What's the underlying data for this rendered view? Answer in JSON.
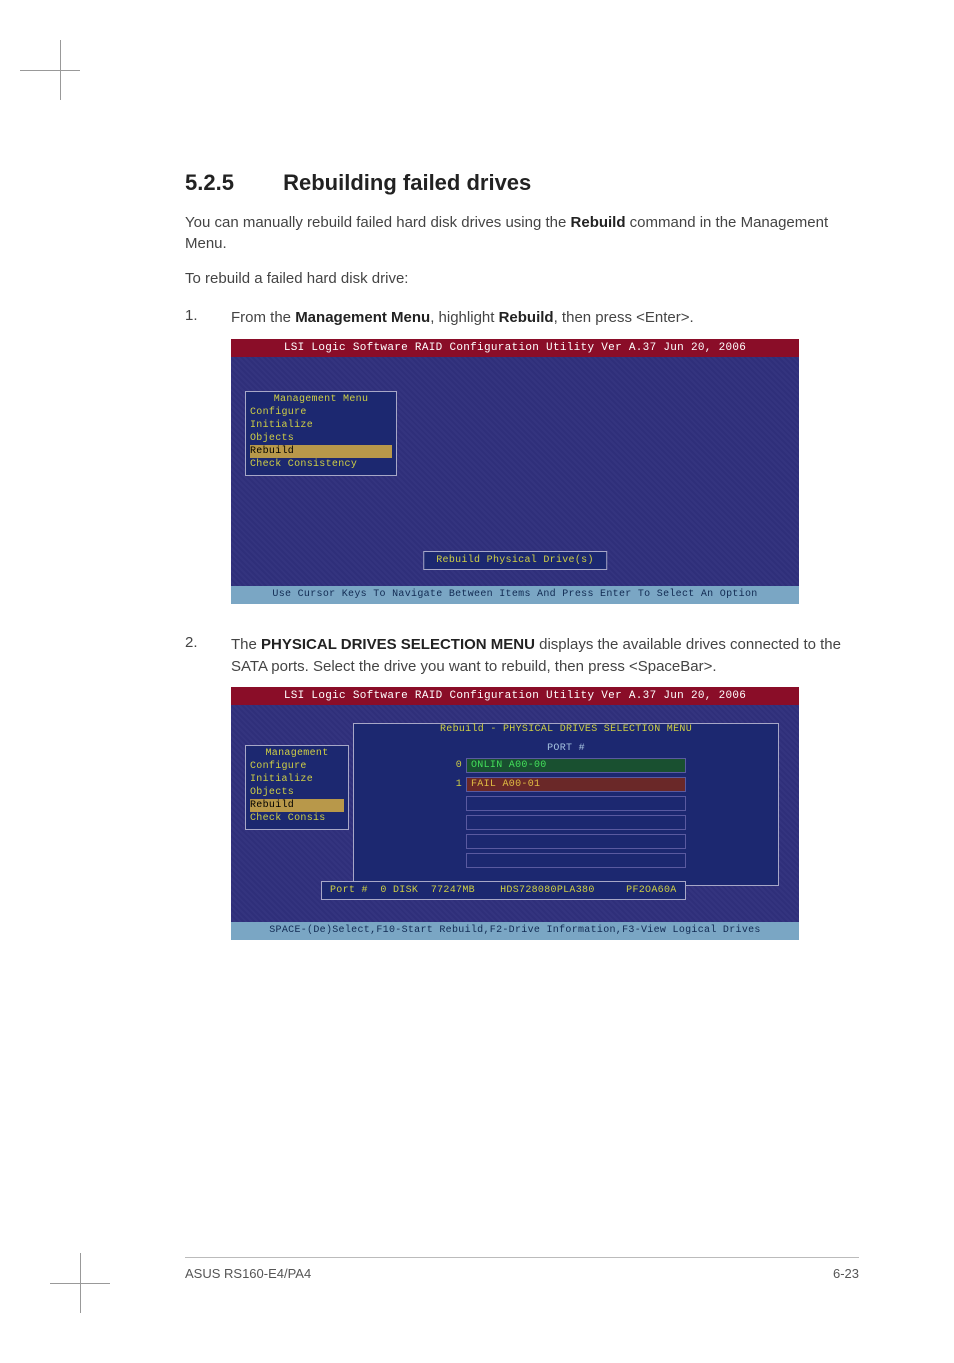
{
  "section": {
    "number": "5.2.5",
    "title": "Rebuilding failed drives"
  },
  "intro1a": "You can manually rebuild failed hard disk drives using the ",
  "intro1_bold": "Rebuild",
  "intro1b": " command in the Management Menu.",
  "intro2": "To rebuild a failed hard disk drive:",
  "steps": [
    {
      "num": "1.",
      "parts": [
        "From the ",
        "Management Menu",
        ", highlight ",
        "Rebuild",
        ", then press <Enter>."
      ]
    },
    {
      "num": "2.",
      "parts": [
        "The ",
        "PHYSICAL DRIVES SELECTION MENU",
        " displays the available drives connected to the SATA ports. Select the drive you want to rebuild, then press <SpaceBar>."
      ]
    }
  ],
  "bios": {
    "titlebar": "LSI Logic Software RAID Configuration Utility Ver A.37 Jun 20, 2006",
    "footer1": "Use Cursor Keys To Navigate Between Items And Press Enter To Select An Option",
    "footer2": "SPACE-(De)Select,F10-Start Rebuild,F2-Drive Information,F3-View Logical Drives",
    "menu_title": "Management Menu",
    "menu_title_short": "Management",
    "menu_items": [
      "Configure",
      "Initialize",
      "Objects",
      "Rebuild",
      "Check Consistency"
    ],
    "menu_items_short": [
      "Configure",
      "Initialize",
      "Objects",
      "Rebuild",
      "Check Consis"
    ],
    "hl_index": 3,
    "center_msg": "Rebuild Physical Drive(s)",
    "sel_title": "Rebuild - PHYSICAL DRIVES SELECTION MENU",
    "port_header": "PORT #",
    "drives": [
      {
        "idx": "0",
        "status": "ONLIN",
        "label": "ONLIN A00-00",
        "cls": "onlin"
      },
      {
        "idx": "1",
        "status": "FAIL",
        "label": "FAIL  A00-01",
        "cls": "fail"
      }
    ],
    "info_box": "Port #  0 DISK  77247MB    HDS728080PLA380     PF2OA60A"
  },
  "footer": {
    "left": "ASUS RS160-E4/PA4",
    "right": "6-23"
  }
}
